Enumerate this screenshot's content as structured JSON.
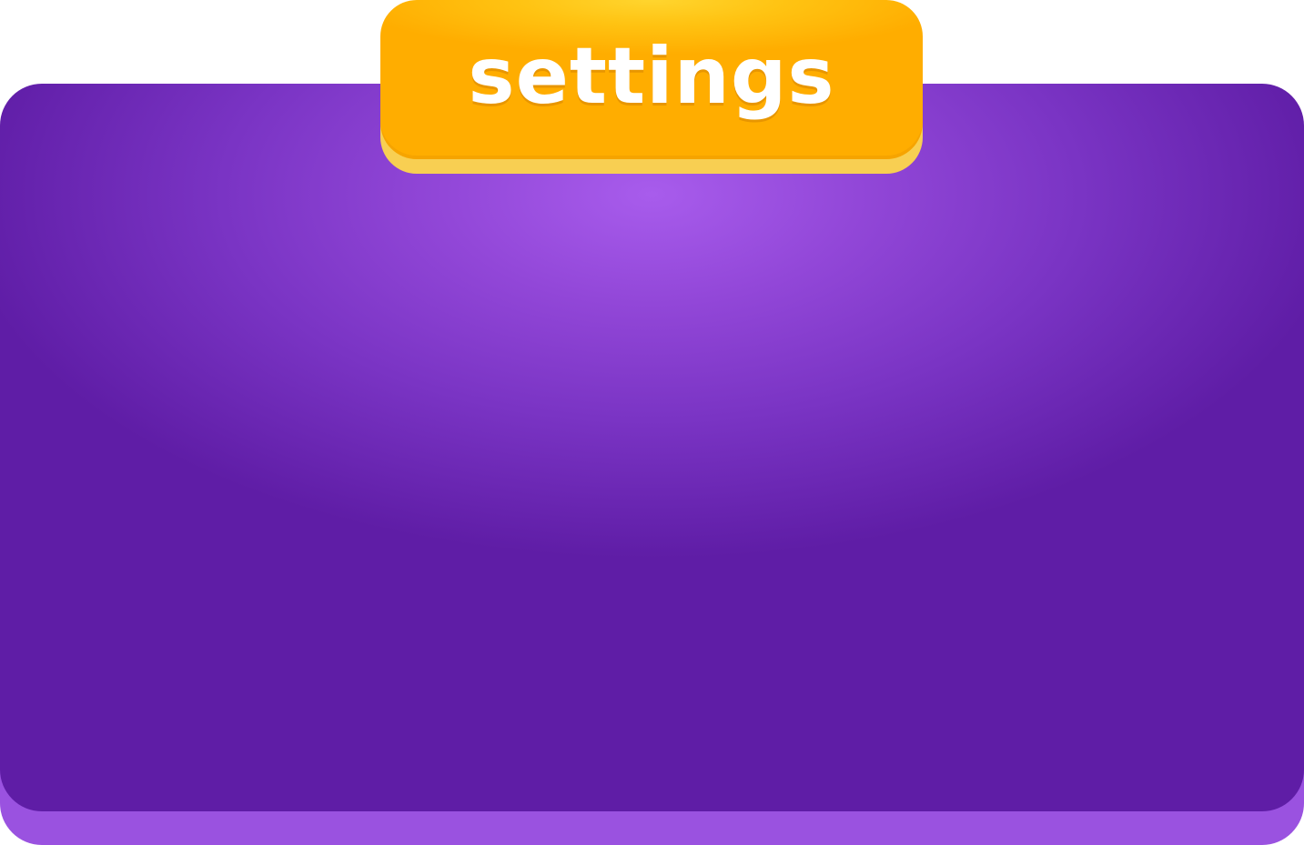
{
  "dialog": {
    "title": "settings"
  },
  "colors": {
    "panel_dark": "#5f1da6",
    "panel_light": "#a85cec",
    "panel_lip": "#9a52e0",
    "tab_top": "#ffd52e",
    "tab_main": "#ffad00",
    "tab_lip": "#f8cf52",
    "title_text": "#ffffff"
  }
}
